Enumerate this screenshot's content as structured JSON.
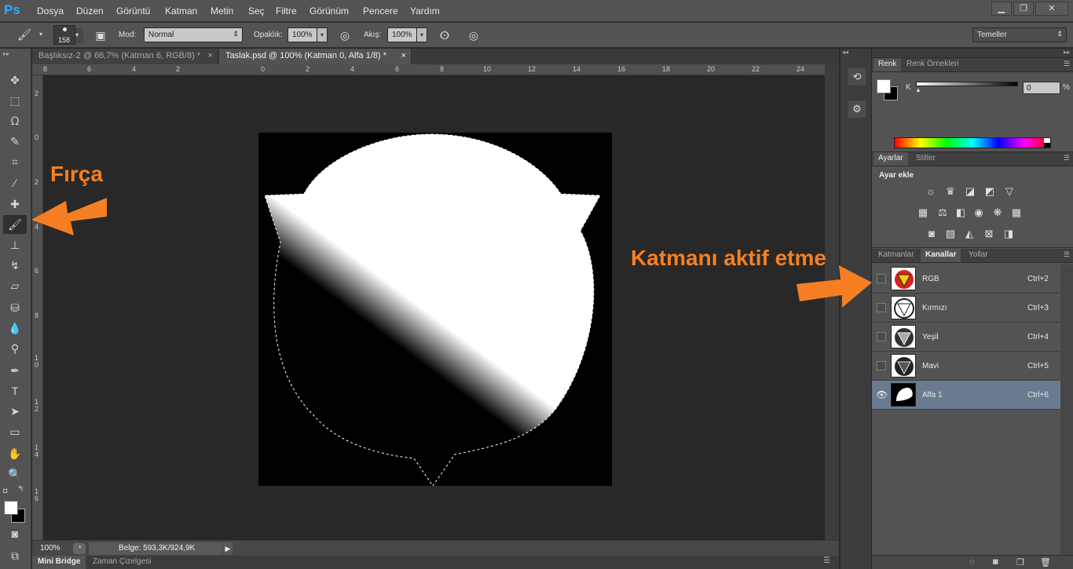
{
  "app": {
    "logo": "Ps"
  },
  "menu": [
    "Dosya",
    "Düzen",
    "Görüntü",
    "Katman",
    "Metin",
    "Seç",
    "Filtre",
    "Görünüm",
    "Pencere",
    "Yardım"
  ],
  "window_buttons": [
    "minimize-icon",
    "restore-icon",
    "close-icon"
  ],
  "options": {
    "brush_size": "158",
    "mode_label": "Mod:",
    "mode_value": "Normal",
    "opacity_label": "Opaklık:",
    "opacity_value": "100%",
    "flow_label": "Akış:",
    "flow_value": "100%",
    "workspace_value": "Temeller"
  },
  "doc_tabs": [
    {
      "label": "Başlıksız-2 @ 66,7% (Katman 6, RGB/8) *",
      "active": false
    },
    {
      "label": "Taslak.psd @ 100% (Katman 0, Alfa 1/8) *",
      "active": true
    }
  ],
  "ruler_h": [
    "8",
    "6",
    "4",
    "2",
    "0",
    "2",
    "4",
    "6",
    "8",
    "10",
    "12",
    "14",
    "16",
    "18",
    "20",
    "22",
    "24"
  ],
  "ruler_v": [
    "2",
    "0",
    "2",
    "4",
    "6",
    "8",
    "1\n0",
    "1\n2",
    "1\n4",
    "1\n6"
  ],
  "status": {
    "zoom": "100%",
    "doc_info": "Belge: 593,3K/924,9K"
  },
  "bottom_tabs": [
    "Mini Bridge",
    "Zaman Çizelgesi"
  ],
  "color_panel": {
    "tabs": [
      "Renk",
      "Renk Örnekleri"
    ],
    "channel_label": "K",
    "value": "0",
    "unit": "%"
  },
  "adjust_panel": {
    "tabs": [
      "Ayarlar",
      "Stiller"
    ],
    "heading": "Ayar ekle"
  },
  "layers_panel": {
    "tabs": [
      "Katmanlar",
      "Kanallar",
      "Yollar"
    ],
    "active_tab": "Kanallar",
    "channels": [
      {
        "name": "RGB",
        "shortcut": "Ctrl+2",
        "selected": false,
        "visible": false
      },
      {
        "name": "Kırmızı",
        "shortcut": "Ctrl+3",
        "selected": false,
        "visible": false
      },
      {
        "name": "Yeşil",
        "shortcut": "Ctrl+4",
        "selected": false,
        "visible": false
      },
      {
        "name": "Mavi",
        "shortcut": "Ctrl+5",
        "selected": false,
        "visible": false
      },
      {
        "name": "Alfa 1",
        "shortcut": "Ctrl+6",
        "selected": true,
        "visible": true
      }
    ]
  },
  "annotations": {
    "brush": "Fırça",
    "channel": "Katmanı aktif etme"
  },
  "colors": {
    "annotation": "#f57f22",
    "selected_row": "#6a7a90",
    "ps_blue": "#31a8ff"
  }
}
